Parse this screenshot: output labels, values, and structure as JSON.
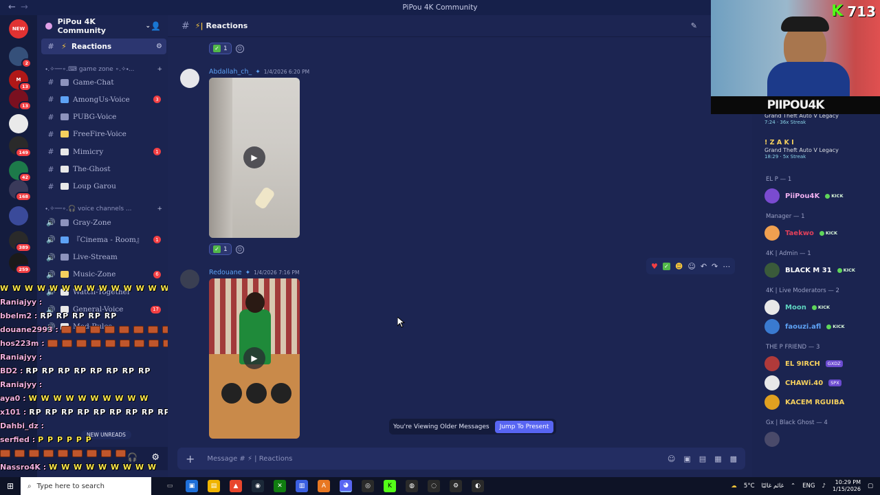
{
  "window": {
    "title": "PiPou 4K Community"
  },
  "server": {
    "name": "PiPou 4K Community",
    "rail": [
      {
        "label": "NEW",
        "color": "#e03232",
        "badge": ""
      },
      {
        "label": "",
        "color": "#35507a",
        "badge": "2"
      },
      {
        "label": "M",
        "color": "#b01818",
        "badge": "13"
      },
      {
        "label": "",
        "color": "#7a1020",
        "badge": "13"
      },
      {
        "label": "",
        "color": "#eaeaea",
        "badge": ""
      },
      {
        "label": "",
        "color": "#2a2a2a",
        "badge": "149"
      },
      {
        "label": "",
        "color": "#1d7a4a",
        "badge": "42"
      },
      {
        "label": "",
        "color": "#3a3a5a",
        "badge": "168"
      },
      {
        "label": "",
        "color": "#3a4a9a",
        "badge": ""
      },
      {
        "label": "",
        "color": "#2a2a2a",
        "badge": "389"
      },
      {
        "label": "",
        "color": "#1a1a1a",
        "badge": "259"
      }
    ]
  },
  "sidebar": {
    "active_channel": "Reactions",
    "categories": [
      {
        "label": "⬩.✧──∘.⌨ game zone ∘.✧⬩..."
      },
      {
        "label": "⬩.✧──∘.🎧 voice channels ..."
      }
    ],
    "game_channels": [
      {
        "name": "Game-Chat",
        "count": ""
      },
      {
        "name": "AmongUs-Voice",
        "count": "3"
      },
      {
        "name": "PUBG-Voice",
        "count": ""
      },
      {
        "name": "FreeFire-Voice",
        "count": ""
      },
      {
        "name": "Mimicry",
        "count": "1"
      },
      {
        "name": "The-Ghost",
        "count": ""
      },
      {
        "name": "Loup Garou",
        "count": ""
      }
    ],
    "voice_channels": [
      {
        "name": "Gray-Zone",
        "count": ""
      },
      {
        "name": "『Cinema - Room』",
        "count": "1"
      },
      {
        "name": "Live-Stream",
        "count": ""
      },
      {
        "name": "Music-Zone",
        "count": "6"
      },
      {
        "name": "Watch-Together",
        "count": ""
      },
      {
        "name": "General-Voice",
        "count": "17"
      },
      {
        "name": "Mod-Rules",
        "count": ""
      }
    ],
    "new_unreads": "NEW UNREADS"
  },
  "chat_overlay": [
    {
      "user": "",
      "msg": "W W W W W W W W W W W W W W W",
      "style": "yellow"
    },
    {
      "user": "Raniajyy :",
      "msg": "",
      "style": "yellow"
    },
    {
      "user": "bbelm2 :",
      "msg": "RP RP RP RP RP",
      "style": "white"
    },
    {
      "user": "douane2993 :",
      "msg": "",
      "style": "bricks"
    },
    {
      "user": "hos223m :",
      "msg": "",
      "style": "bricks"
    },
    {
      "user": "Raniajyy :",
      "msg": "",
      "style": "yellow"
    },
    {
      "user": "BD2 :",
      "msg": "RP RP RP RP RP RP RP RP",
      "style": "white"
    },
    {
      "user": "Raniajyy :",
      "msg": "",
      "style": "yellow"
    },
    {
      "user": "aya0 :",
      "msg": "W W W W W W W W W W",
      "style": "yellow"
    },
    {
      "user": "x101 :",
      "msg": "RP RP RP RP RP RP RP RP RP",
      "style": "white"
    },
    {
      "user": "Dahbi_dz :",
      "msg": "",
      "style": "yellow"
    },
    {
      "user": "serfied :",
      "msg": "P P P P P P",
      "style": "yellow"
    },
    {
      "user": "",
      "msg": "",
      "style": "bricks"
    },
    {
      "user": "Nassro4K :",
      "msg": "W W W W W W W W W",
      "style": "yellow"
    }
  ],
  "channel_header": {
    "name": "Reactions"
  },
  "messages": [
    {
      "reaction_count": "1"
    },
    {
      "author": "Abdallah_ch_",
      "time": "1/4/2026 6:20 PM",
      "reaction_count": "1"
    },
    {
      "author": "Redouane",
      "time": "1/4/2026 7:16 PM"
    }
  ],
  "older_banner": {
    "text": "You're Viewing Older Messages",
    "button": "Jump To Present"
  },
  "composer": {
    "placeholder": "Message # ⚡ | Reactions"
  },
  "members": {
    "activities": [
      {
        "name": "",
        "game": "Grand Theft Auto V Legacy",
        "meta": "7:24 · 36x Streak"
      },
      {
        "name": "! Z A K I",
        "game": "Grand Theft Auto V Legacy",
        "meta": "18:29 · 5x Streak"
      }
    ],
    "groups": [
      {
        "header": "EL P — 1",
        "members": [
          {
            "name": "PiiPou4K",
            "color": "#f0b0f0",
            "tag": "KICK"
          }
        ]
      },
      {
        "header": "Manager — 1",
        "members": [
          {
            "name": "Taekwo",
            "color": "#e2405a",
            "tag": "KICK"
          }
        ]
      },
      {
        "header": "4K | Admin — 1",
        "members": [
          {
            "name": "BLACK M 31",
            "color": "#ffffff",
            "tag": "KICK"
          }
        ]
      },
      {
        "header": "4K | Live Moderators — 2",
        "members": [
          {
            "name": "Moon",
            "color": "#5fd6c0",
            "tag": "KICK"
          },
          {
            "name": "faouzi.afl",
            "color": "#5ea2f5",
            "tag": "KICK"
          }
        ]
      },
      {
        "header": "THE P FRIEND — 3",
        "members": [
          {
            "name": "EL 9IRCH",
            "color": "#f5d05e",
            "tag": "GXDZ"
          },
          {
            "name": "CHAWi.40",
            "color": "#f5d05e",
            "tag": "SPX"
          },
          {
            "name": "KACEM RGUIBA",
            "color": "#f5d05e",
            "tag": ""
          }
        ]
      },
      {
        "header": "Gx | Black Ghost — 4",
        "members": [
          {
            "name": "",
            "color": "#ffffff",
            "tag": ""
          }
        ]
      }
    ]
  },
  "webcam": {
    "views": "713",
    "banner": "PIIPOU4K"
  },
  "taskbar": {
    "search_placeholder": "Type here to search",
    "weather": "5°C",
    "weather_desc": "غائم غالبًا",
    "lang": "ENG",
    "time": "10:29 PM",
    "date": "1/15/2026"
  },
  "colors": {
    "accent": "#5865f2",
    "bg": "#1c2552",
    "badge": "#f23f43",
    "kick": "#53fc18"
  }
}
